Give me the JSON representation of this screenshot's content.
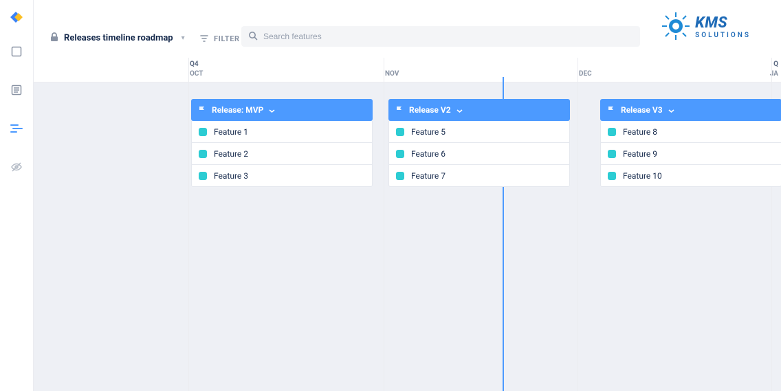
{
  "header": {
    "title": "Releases timeline roadmap",
    "filter_label": "FILTER",
    "search_placeholder": "Search features"
  },
  "brand": {
    "main": "KMS",
    "sub": "SOLUTIONS"
  },
  "timeline": {
    "quarter_left": "Q4",
    "quarter_right": "Q",
    "months": {
      "oct": "OCT",
      "nov": "NOV",
      "dec": "DEC",
      "ja": "JA"
    }
  },
  "columns": [
    {
      "title": "Release: MVP",
      "features": [
        "Feature 1",
        "Feature 2",
        "Feature 3"
      ]
    },
    {
      "title": "Release V2",
      "features": [
        "Feature 5",
        "Feature 6",
        "Feature 7"
      ]
    },
    {
      "title": "Release V3",
      "features": [
        "Feature 8",
        "Feature 9",
        "Feature 10"
      ]
    }
  ],
  "colors": {
    "accent": "#4c9aff",
    "feature_swatch": "#2cccd3"
  }
}
